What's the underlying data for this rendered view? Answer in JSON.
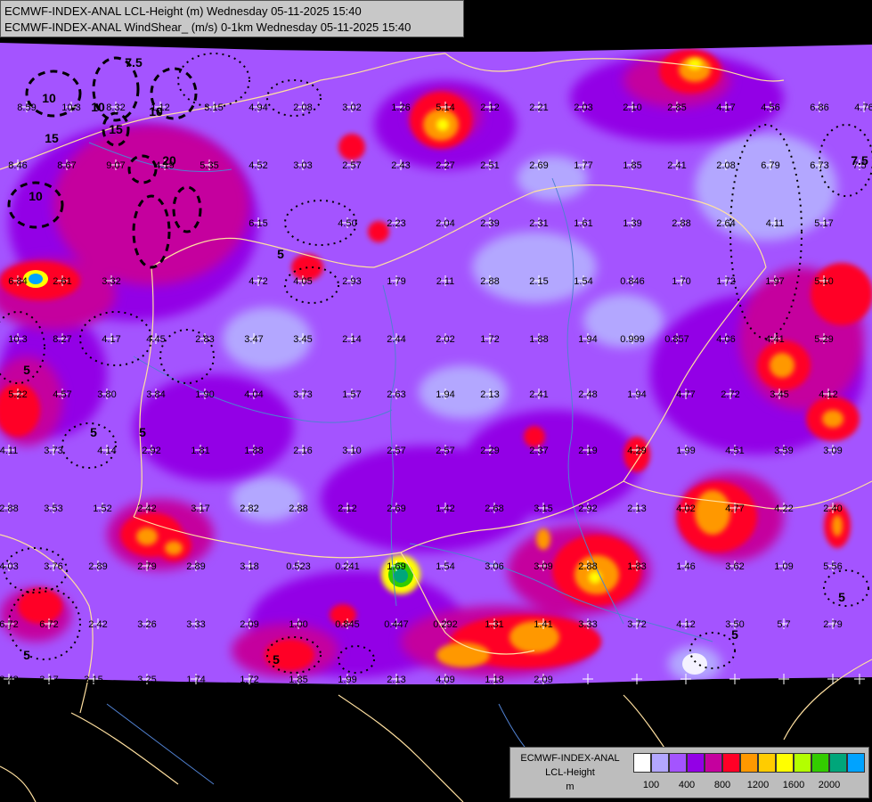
{
  "header": {
    "line1": "ECMWF-INDEX-ANAL LCL-Height (m) Wednesday 05-11-2025 15:40",
    "line2": "ECMWF-INDEX-ANAL WindShear_ (m/s) 0-1km Wednesday 05-11-2025 15:40"
  },
  "legend": {
    "line1": "ECMWF-INDEX-ANAL",
    "line2": "LCL-Height",
    "line3": "m",
    "colors": [
      "#ffffff",
      "#b3a7ff",
      "#a454ff",
      "#9300e6",
      "#c5009e",
      "#ff0026",
      "#ff9800",
      "#ffcc00",
      "#ffff00",
      "#b3ff00",
      "#33cc00",
      "#00a67a",
      "#00a3ff"
    ],
    "ticks": [
      "100",
      "400",
      "800",
      "1200",
      "1600",
      "2000"
    ]
  },
  "map_colors": {
    "background": "#000000",
    "base": "#a454ff",
    "light": "#b3a7ff",
    "mid": "#9300e6",
    "magenta": "#c5009e",
    "red": "#ff0026",
    "orange": "#ff9800",
    "yellow": "#ffff00",
    "green": "#33cc00",
    "teal": "#00a67a",
    "border": "#ffe0a0",
    "river": "#5080d0"
  },
  "station_values": [
    "8.59",
    "10.3",
    "8.32",
    "1.12",
    "3.15",
    "4.94",
    "2.08",
    "3.02",
    "1.26",
    "5.14",
    "2.12",
    "2.21",
    "2.03",
    "2.10",
    "2.85",
    "4.17",
    "4.56",
    "6.86",
    "4.76",
    "8.46",
    "8.67",
    "9.07",
    "4.19",
    "5.35",
    "4.52",
    "3.03",
    "2.57",
    "2.43",
    "2.27",
    "2.51",
    "2.69",
    "1.77",
    "1.85",
    "2.41",
    "2.08",
    "6.79",
    "6.73",
    "7.5",
    "6.15",
    "4.50",
    "2.23",
    "2.04",
    "2.39",
    "2.31",
    "1.61",
    "1.39",
    "2.88",
    "2.64",
    "4.11",
    "5.17",
    "6.84",
    "2.61",
    "3.32",
    "4.72",
    "4.05",
    "2.93",
    "1.79",
    "2.11",
    "2.88",
    "2.15",
    "1.54",
    "0.846",
    "1.70",
    "1.72",
    "1.97",
    "5.10",
    "10.3",
    "8.27",
    "4.17",
    "4.45",
    "2.83",
    "3.47",
    "3.45",
    "2.14",
    "2.44",
    "2.02",
    "1.72",
    "1.88",
    "1.94",
    "0.999",
    "0.857",
    "4.06",
    "4.41",
    "5.29",
    "5.22",
    "4.57",
    "3.80",
    "3.84",
    "1.90",
    "4.04",
    "3.73",
    "1.57",
    "2.63",
    "1.94",
    "2.13",
    "2.41",
    "2.48",
    "1.94",
    "4.77",
    "2.72",
    "3.45",
    "4.12",
    "4.11",
    "3.73",
    "4.14",
    "2.92",
    "1.81",
    "1.88",
    "2.16",
    "3.10",
    "2.57",
    "2.57",
    "2.29",
    "2.37",
    "2.19",
    "4.29",
    "1.99",
    "4.51",
    "3.59",
    "3.09",
    "2.88",
    "3.53",
    "1.52",
    "2.42",
    "3.17",
    "2.82",
    "2.88",
    "2.12",
    "2.69",
    "1.42",
    "2.68",
    "3.15",
    "2.92",
    "2.13",
    "4.02",
    "4.77",
    "4.22",
    "2.40",
    "4.03",
    "3.76",
    "2.89",
    "2.79",
    "2.89",
    "3.18",
    "0.523",
    "0.241",
    "1.69",
    "1.54",
    "3.06",
    "3.09",
    "2.88",
    "1.83",
    "1.46",
    "3.62",
    "1.09",
    "5.56",
    "6.72",
    "6.72",
    "2.42",
    "3.26",
    "3.33",
    "2.09",
    "1.00",
    "0.845",
    "0.447",
    "0.292",
    "1.31",
    "1.41",
    "3.33",
    "3.72",
    "4.12",
    "3.50",
    "5.7",
    "2.79",
    "3.43",
    "3.17",
    "3.15",
    "3.25",
    "1.74",
    "1.72",
    "1.85",
    "1.99",
    "2.13",
    "4.09",
    "1.18",
    "2.09"
  ],
  "contour_labels": [
    "7.5",
    "10",
    "10",
    "15",
    "10",
    "15",
    "10",
    "20",
    "5",
    "5",
    "5",
    "5",
    "7.5",
    "5",
    "5",
    "5",
    "5"
  ]
}
